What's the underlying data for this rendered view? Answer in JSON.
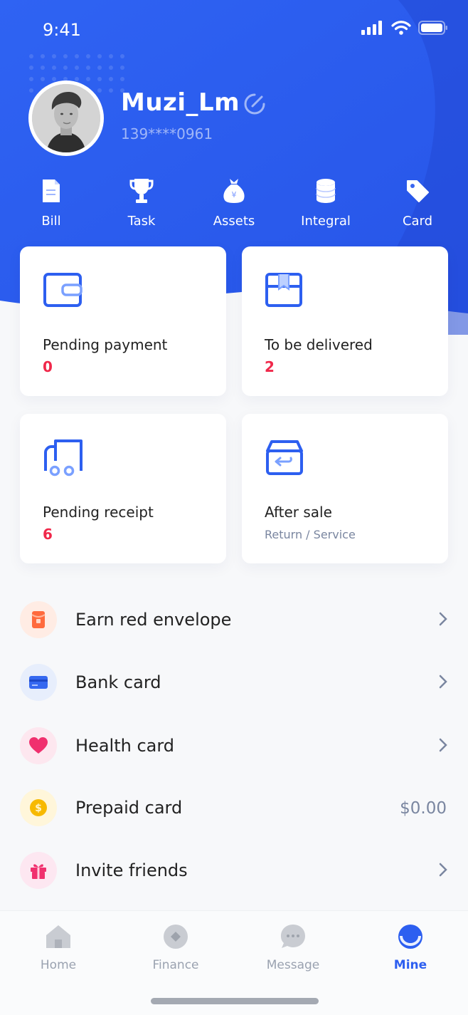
{
  "status": {
    "time": "9:41"
  },
  "profile": {
    "username": "Muzi_Lm",
    "phone": "139****0961"
  },
  "quick_menu": [
    {
      "label": "Bill",
      "icon": "bill-icon"
    },
    {
      "label": "Task",
      "icon": "trophy-icon"
    },
    {
      "label": "Assets",
      "icon": "money-bag-icon"
    },
    {
      "label": "Integral",
      "icon": "coins-stack-icon"
    },
    {
      "label": "Card",
      "icon": "tag-icon"
    }
  ],
  "orders": [
    {
      "title": "Pending payment",
      "count": "0",
      "icon": "wallet-icon"
    },
    {
      "title": "To be delivered",
      "count": "2",
      "icon": "box-icon"
    },
    {
      "title": "Pending receipt",
      "count": "6",
      "icon": "truck-icon"
    },
    {
      "title": "After sale",
      "subtitle": "Return / Service",
      "icon": "return-box-icon"
    }
  ],
  "menu_list": [
    {
      "label": "Earn red envelope",
      "icon": "red-envelope-icon"
    },
    {
      "label": "Bank card",
      "icon": "bank-card-icon"
    },
    {
      "label": "Health card",
      "icon": "heart-icon"
    },
    {
      "label": "Prepaid card",
      "icon": "dollar-coin-icon",
      "value": "$0.00"
    },
    {
      "label": "Invite friends",
      "icon": "gift-icon"
    }
  ],
  "tabs": [
    {
      "label": "Home",
      "icon": "home-icon"
    },
    {
      "label": "Finance",
      "icon": "finance-icon"
    },
    {
      "label": "Message",
      "icon": "message-icon"
    },
    {
      "label": "Mine",
      "icon": "mine-icon",
      "active": true
    }
  ],
  "colors": {
    "brand": "#2d5ff0",
    "accent_red": "#f0284a",
    "muted": "#7a86a0"
  }
}
